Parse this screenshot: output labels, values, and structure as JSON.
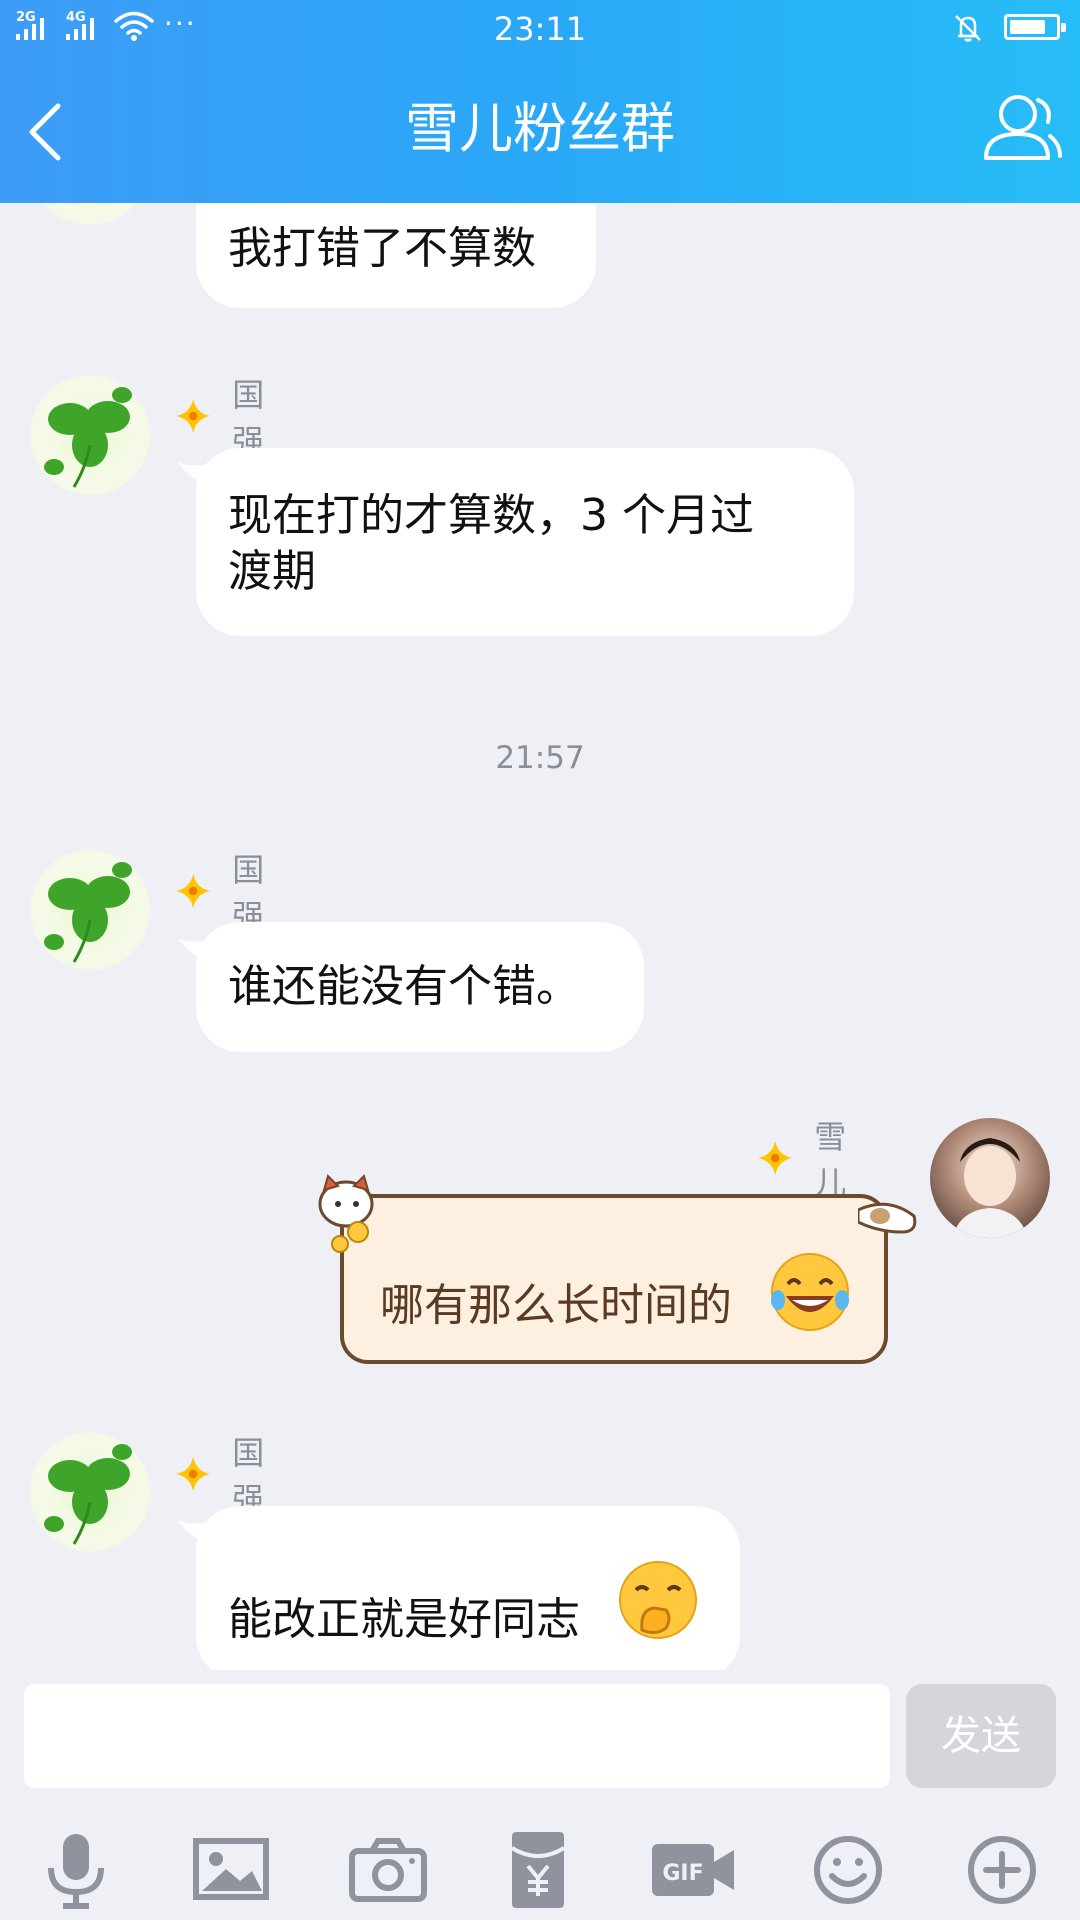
{
  "status_bar": {
    "sim1": "2G",
    "sim2": "4G",
    "dots": "···",
    "time": "23:11",
    "battery_level": 0.8
  },
  "header": {
    "title": "雪儿粉丝群"
  },
  "messages": [
    {
      "sender": "",
      "text": "我打错了不算数"
    },
    {
      "sender": "国强",
      "text_line1": "现在打的才算数，3 个月过",
      "text_line2": "渡期"
    },
    {
      "sender": "国强",
      "text": "谁还能没有个错。"
    },
    {
      "sender": "雪儿",
      "text": "哪有那么长时间的"
    },
    {
      "sender": "国强",
      "text": "能改正就是好同志"
    }
  ],
  "timestamp": "21:57",
  "input": {
    "value": "",
    "send_label": "发送"
  },
  "toolbar_icons": [
    "microphone-icon",
    "image-icon",
    "camera-icon",
    "red-packet-icon",
    "gif-icon",
    "emoji-icon",
    "plus-icon"
  ],
  "colors": {
    "header_start": "#3d9cf7",
    "header_end": "#27bdf7",
    "background": "#eef0f6",
    "bubble": "#ffffff",
    "send_disabled": "#d4d6dc",
    "badge": "#ffc400"
  }
}
